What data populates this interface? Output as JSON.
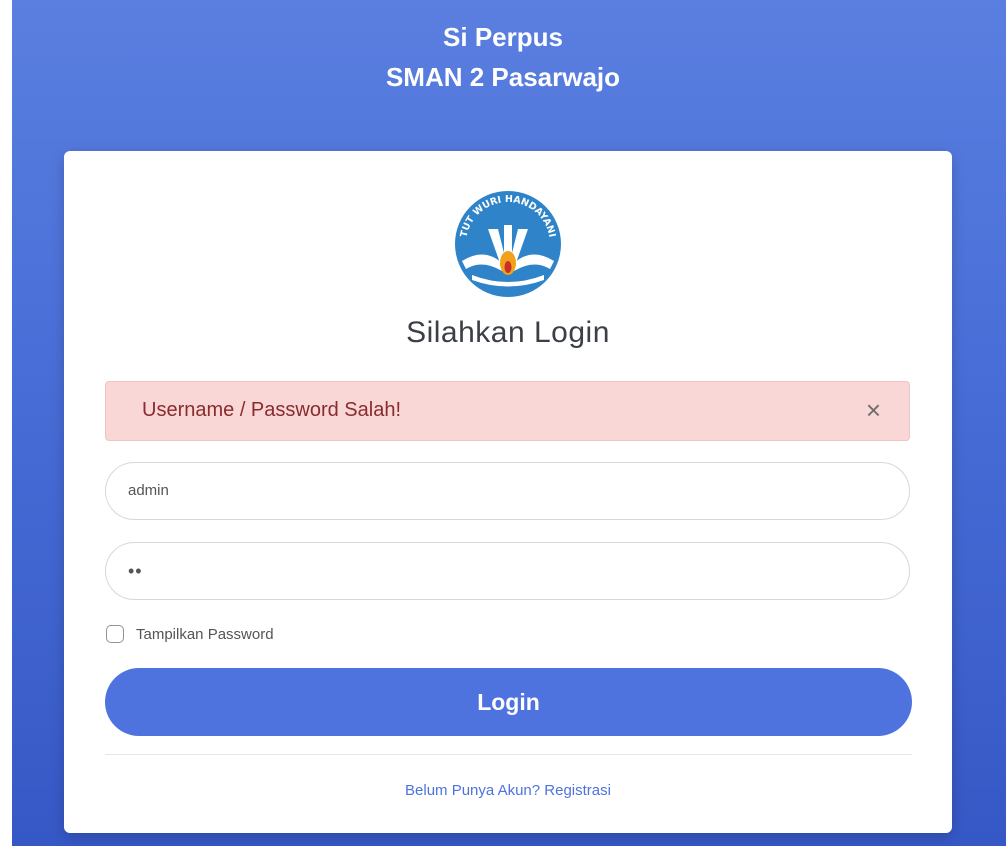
{
  "header": {
    "app_name": "Si Perpus",
    "school_name": "SMAN 2 Pasarwajo"
  },
  "logo": {
    "text": "TUT WURI HANDAYANI",
    "colors": {
      "blue": "#2f84c9",
      "white": "#ffffff",
      "gold": "#f0a21a",
      "red": "#c9302c"
    }
  },
  "card": {
    "title": "Silahkan Login"
  },
  "alert": {
    "message": "Username / Password Salah!",
    "close_icon": "×"
  },
  "form": {
    "username_value": "admin",
    "password_masked": "••",
    "show_password_label": "Tampilkan Password",
    "login_button": "Login",
    "register_link": "Belum Punya Akun? Registrasi"
  },
  "colors": {
    "accent": "#4e73df",
    "alert_bg": "#f8d7d6",
    "alert_text": "#8a2b2d"
  }
}
